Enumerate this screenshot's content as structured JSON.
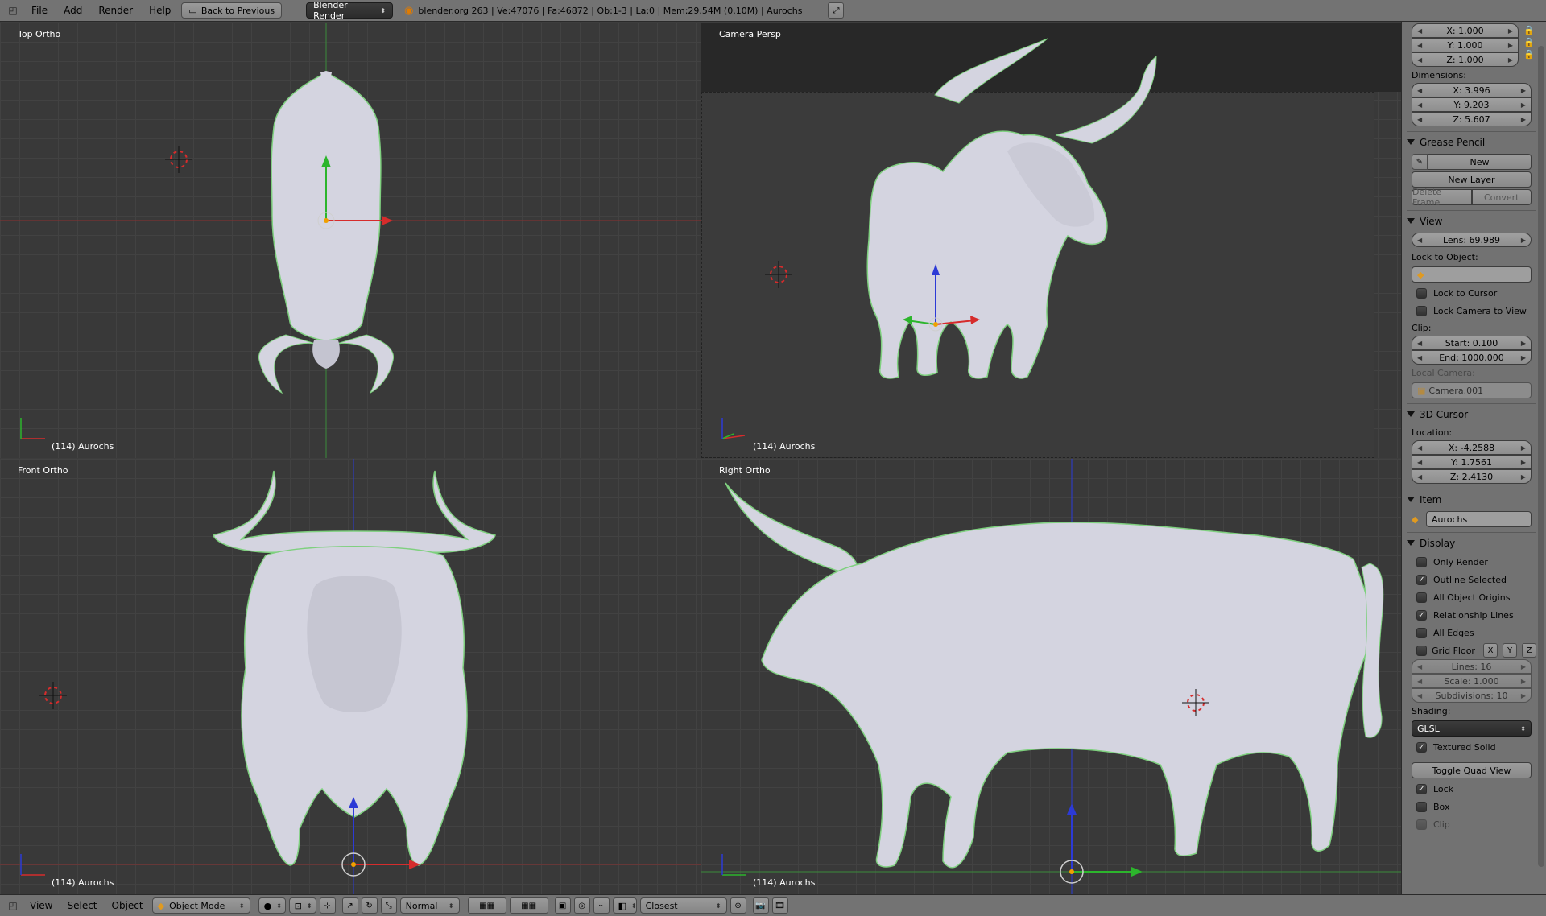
{
  "header": {
    "menus": [
      "File",
      "Add",
      "Render",
      "Help"
    ],
    "back_button": "Back to Previous",
    "engine": "Blender Render",
    "stats": "blender.org 263 | Ve:47076 | Fa:46872 | Ob:1-3 | La:0 | Mem:29.54M (0.10M) | Aurochs"
  },
  "viewports": {
    "top": {
      "label": "Top Ortho",
      "footer": "(114) Aurochs"
    },
    "camera": {
      "label": "Camera Persp",
      "footer": "(114) Aurochs"
    },
    "front": {
      "label": "Front Ortho",
      "footer": "(114) Aurochs"
    },
    "right": {
      "label": "Right Ortho",
      "footer": "(114) Aurochs"
    }
  },
  "panel": {
    "scale": {
      "x": "X: 1.000",
      "y": "Y: 1.000",
      "z": "Z: 1.000"
    },
    "dimensions": {
      "label": "Dimensions:",
      "x": "X: 3.996",
      "y": "Y: 9.203",
      "z": "Z: 5.607"
    },
    "grease_pencil": {
      "title": "Grease Pencil",
      "new": "New",
      "new_layer": "New Layer",
      "delete_frame": "Delete Frame",
      "convert": "Convert"
    },
    "view": {
      "title": "View",
      "lens": "Lens: 69.989",
      "lock_to_object": "Lock to Object:",
      "lock_to_cursor": "Lock to Cursor",
      "lock_camera": "Lock Camera to View",
      "clip": "Clip:",
      "clip_start": "Start: 0.100",
      "clip_end": "End: 1000.000",
      "local_camera": "Local Camera:",
      "camera_name": "Camera.001"
    },
    "cursor": {
      "title": "3D Cursor",
      "location": "Location:",
      "x": "X: -4.2588",
      "y": "Y: 1.7561",
      "z": "Z: 2.4130"
    },
    "item": {
      "title": "Item",
      "name": "Aurochs"
    },
    "display": {
      "title": "Display",
      "only_render": "Only Render",
      "outline_selected": "Outline Selected",
      "all_object_origins": "All Object Origins",
      "relationship_lines": "Relationship Lines",
      "all_edges": "All Edges",
      "grid_floor": "Grid Floor",
      "axis_x": "X",
      "axis_y": "Y",
      "axis_z": "Z",
      "lines": "Lines: 16",
      "scale": "Scale: 1.000",
      "subdivisions": "Subdivisions: 10",
      "shading": "Shading:",
      "shading_value": "GLSL",
      "textured_solid": "Textured Solid",
      "toggle_quad": "Toggle Quad View",
      "lock": "Lock",
      "box": "Box",
      "clip": "Clip"
    }
  },
  "footer": {
    "menus": [
      "View",
      "Select",
      "Object"
    ],
    "mode": "Object Mode",
    "pivot": "Normal",
    "snap": "Closest"
  },
  "colors": {
    "x_axis": "#d62c2c",
    "y_axis": "#2cb52c",
    "z_axis": "#2c3ad6",
    "mesh": "#d8d8e4",
    "outline": "#7fd07f"
  }
}
